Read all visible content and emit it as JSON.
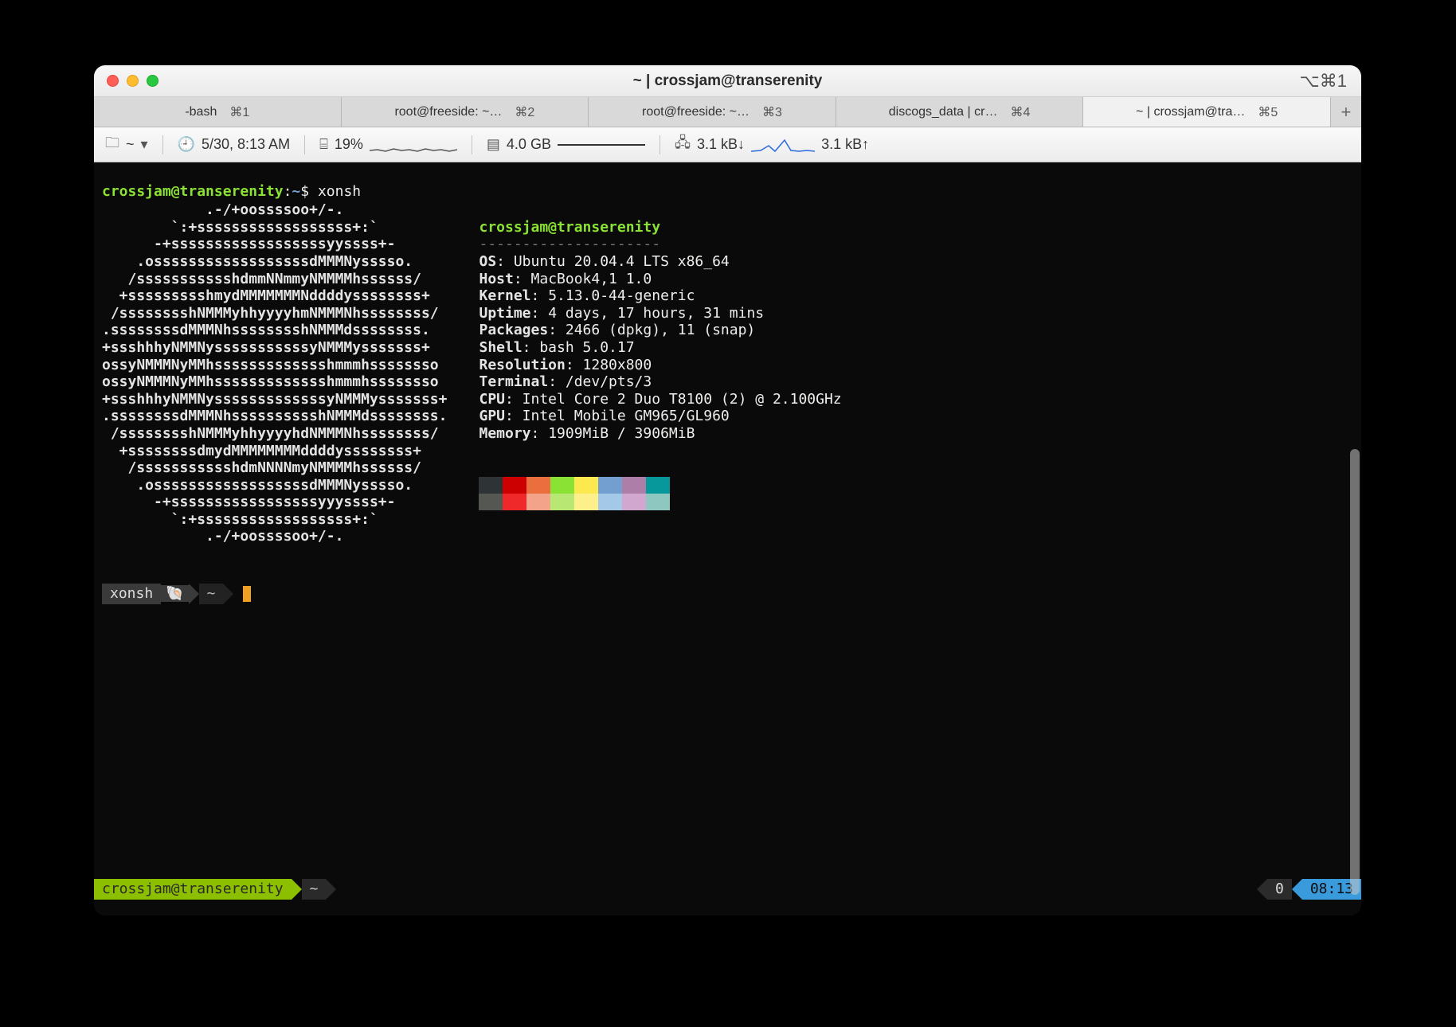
{
  "window_title": "~ | crossjam@transerenity",
  "title_shortcut": "⌥⌘1",
  "tabs": [
    {
      "label": "-bash",
      "shortcut": "⌘1"
    },
    {
      "label": "root@freeside: ~…",
      "shortcut": "⌘2"
    },
    {
      "label": "root@freeside: ~…",
      "shortcut": "⌘3"
    },
    {
      "label": "discogs_data | cr…",
      "shortcut": "⌘4"
    },
    {
      "label": "~ | crossjam@tra…",
      "shortcut": "⌘5"
    }
  ],
  "newtab_glyph": "+",
  "status": {
    "folder": "~",
    "clock": "5/30, 8:13 AM",
    "cpu": "19%",
    "mem": "4.0 GB",
    "net_down": "3.1 kB↓",
    "net_up": "3.1 kB↑"
  },
  "prompt": {
    "user": "crossjam@transerenity",
    "sep": ":",
    "cwd": "~",
    "sym": "$",
    "command": "xonsh"
  },
  "ascii_logo": [
    "            .-/+oossssoo+/-.",
    "        `:+ssssssssssssssssss+:`",
    "      -+ssssssssssssssssssyyssss+-",
    "    .ossssssssssssssssssdMMMNysssso.",
    "   /ssssssssssshdmmNNmmyNMMMMhssssss/",
    "  +ssssssssshmydMMMMMMMNddddyssssssss+",
    " /sssssssshNMMMyhhyyyyhmNMMMNhssssssss/",
    ".ssssssssdMMMNhsssssssshNMMMdssssssss.",
    "+ssshhhyNMMNysssssssssssyNMMMysssssss+",
    "ossyNMMMNyMMhssssssssssssshmmmhssssssso",
    "ossyNMMMNyMMhssssssssssssshmmmhssssssso",
    "+ssshhhyNMMNysssssssssssssyNMMMysssssss+",
    ".ssssssssdMMMNhsssssssssshNMMMdssssssss.",
    " /sssssssshNMMMyhhyyyyhdNMMMNhssssssss/",
    "  +ssssssssdmydMMMMMMMMddddyssssssss+",
    "   /ssssssssssshdmNNNNmyNMMMMhssssss/",
    "    .ossssssssssssssssssdMMMNysssso.",
    "      -+sssssssssssssssssyyyssss+-",
    "        `:+ssssssssssssssssss+:`",
    "            .-/+oossssoo+/-."
  ],
  "info_header": "crossjam@transerenity",
  "info_sep": "---------------------",
  "info": [
    {
      "k": "OS",
      "v": "Ubuntu 20.04.4 LTS x86_64"
    },
    {
      "k": "Host",
      "v": "MacBook4,1 1.0"
    },
    {
      "k": "Kernel",
      "v": "5.13.0-44-generic"
    },
    {
      "k": "Uptime",
      "v": "4 days, 17 hours, 31 mins"
    },
    {
      "k": "Packages",
      "v": "2466 (dpkg), 11 (snap)"
    },
    {
      "k": "Shell",
      "v": "bash 5.0.17"
    },
    {
      "k": "Resolution",
      "v": "1280x800"
    },
    {
      "k": "Terminal",
      "v": "/dev/pts/3"
    },
    {
      "k": "CPU",
      "v": "Intel Core 2 Duo T8100 (2) @ 2.100GHz"
    },
    {
      "k": "GPU",
      "v": "Intel Mobile GM965/GL960"
    },
    {
      "k": "Memory",
      "v": "1909MiB / 3906MiB"
    }
  ],
  "swatches_top": [
    "#2e3436",
    "#cc0000",
    "#eb6e3e",
    "#8ae234",
    "#fce94f",
    "#729fcf",
    "#ad7fa8",
    "#06989a"
  ],
  "swatches_bot": [
    "#555753",
    "#ef2929",
    "#f2a38a",
    "#b8e774",
    "#fdf08a",
    "#a4c8e8",
    "#d1a7d0",
    "#8ec7c0"
  ],
  "xonsh_prompt": {
    "shell": "xonsh",
    "snail": "🐚",
    "cwd": "~"
  },
  "bottom": {
    "userhost": "crossjam@transerenity",
    "cwd": "~",
    "exit": "0",
    "time": "08:13"
  }
}
